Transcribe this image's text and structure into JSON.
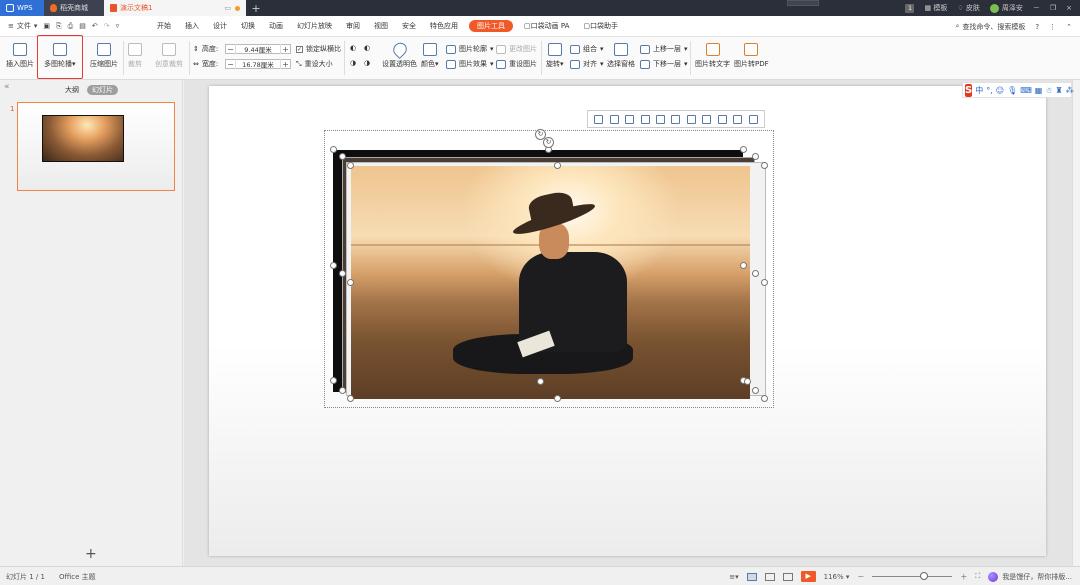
{
  "titlebar": {
    "tabs": [
      {
        "label": "WPS"
      },
      {
        "label": "稻壳商城"
      },
      {
        "label": "演示文稿1"
      }
    ],
    "add_tab": "+",
    "template": "模板",
    "skin": "皮肤",
    "user": "周泽安",
    "minimize": "－",
    "restore": "❐",
    "close": "×"
  },
  "menubar": {
    "file": "文件",
    "items": [
      "开始",
      "插入",
      "设计",
      "切换",
      "动画",
      "幻灯片放映",
      "审阅",
      "视图",
      "安全",
      "特色应用"
    ],
    "active": "图片工具",
    "extra": [
      "口袋动画 PA",
      "口袋助手"
    ],
    "search": "查找命令、搜索模板",
    "help": "?"
  },
  "ribbon": {
    "insert_picture": "插入图片",
    "multi_outline": "多图轮播",
    "compress": "压缩图片",
    "crop": "裁剪",
    "creative_crop": "创意裁剪",
    "height_label": "高度:",
    "height_value": "9.44厘米",
    "width_label": "宽度:",
    "width_value": "16.78厘米",
    "lock_ratio": "锁定纵横比",
    "reset_size": "重设大小",
    "set_transparent": "设置透明色",
    "color": "颜色",
    "picture_outline": "图片轮廓",
    "change_picture": "更改图片",
    "picture_effect": "图片效果",
    "reset_picture": "重设图片",
    "rotate": "旋转",
    "group": "组合",
    "align": "对齐",
    "select_pane": "选择窗格",
    "bring_forward": "上移一层",
    "send_backward": "下移一层",
    "pic_to_text": "图片转文字",
    "pic_to_pdf": "图片转PDF"
  },
  "leftpanel": {
    "tab_outline": "大纲",
    "tab_slides": "幻灯片",
    "slide_number": "1",
    "add": "+"
  },
  "ime": {
    "logo": "S",
    "mode": "中"
  },
  "statusbar": {
    "slide_info": "幻灯片 1 / 1",
    "theme": "Office 主题",
    "zoom": "116%",
    "zoom_minus": "－",
    "zoom_plus": "＋",
    "assistant": "我是馒仔，帮你排版..."
  },
  "colors": {
    "accent": "#f05a28",
    "highlight_box": "#e5393a",
    "titlebar": "#2b2f3a"
  }
}
